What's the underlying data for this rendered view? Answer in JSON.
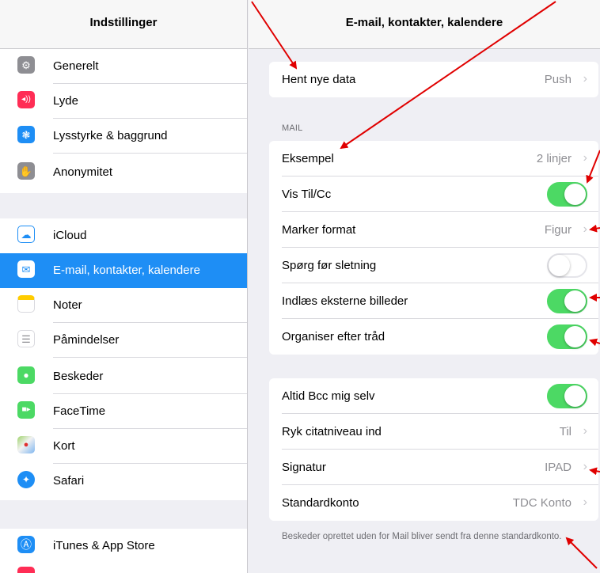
{
  "sidebar": {
    "title": "Indstillinger",
    "items": [
      {
        "label": "Generelt",
        "icon": "gear-icon",
        "color": "#8e8e93",
        "glyph": "⚙"
      },
      {
        "label": "Lyde",
        "icon": "speaker-icon",
        "color": "#ff2d55",
        "glyph": "🔊"
      },
      {
        "label": "Lysstyrke & baggrund",
        "icon": "flower-icon",
        "color": "#1e8ef5",
        "glyph": "❃"
      },
      {
        "label": "Anonymitet",
        "icon": "hand-icon",
        "color": "#8e8e93",
        "glyph": "✋"
      },
      {
        "label": "iCloud",
        "icon": "cloud-icon",
        "color": "#ffffff",
        "glyph": "☁"
      },
      {
        "label": "E-mail, kontakter, kalendere",
        "icon": "mail-icon",
        "color": "#1e8ef5",
        "glyph": "✉"
      },
      {
        "label": "Noter",
        "icon": "notes-icon",
        "color": "#ffcc00",
        "glyph": "▤"
      },
      {
        "label": "Påmindelser",
        "icon": "reminders-icon",
        "color": "#ffffff",
        "glyph": "☰"
      },
      {
        "label": "Beskeder",
        "icon": "messages-icon",
        "color": "#4cd964",
        "glyph": "💬"
      },
      {
        "label": "FaceTime",
        "icon": "facetime-icon",
        "color": "#4cd964",
        "glyph": "▶"
      },
      {
        "label": "Kort",
        "icon": "maps-icon",
        "color": "#f2f2f2",
        "glyph": "◆"
      },
      {
        "label": "Safari",
        "icon": "safari-icon",
        "color": "#1e8ef5",
        "glyph": "🧭"
      },
      {
        "label": "iTunes & App Store",
        "icon": "appstore-icon",
        "color": "#1e8ef5",
        "glyph": "Ⓐ"
      }
    ]
  },
  "detail": {
    "title": "E-mail, kontakter, kalendere",
    "fetch": {
      "label": "Hent nye data",
      "value": "Push"
    },
    "mail_header": "MAIL",
    "mail_rows": [
      {
        "label": "Eksempel",
        "value": "2 linjer"
      },
      {
        "label": "Vis Til/Cc",
        "toggle": "on"
      },
      {
        "label": "Marker format",
        "value": "Figur"
      },
      {
        "label": "Spørg før sletning",
        "toggle": "off"
      },
      {
        "label": "Indlæs eksterne billeder",
        "toggle": "on"
      },
      {
        "label": "Organiser efter tråd",
        "toggle": "on"
      }
    ],
    "other_rows": [
      {
        "label": "Altid Bcc mig selv",
        "toggle": "on"
      },
      {
        "label": "Ryk citatniveau ind",
        "value": "Til"
      },
      {
        "label": "Signatur",
        "value": "IPAD"
      },
      {
        "label": "Standardkonto",
        "value": "TDC Konto"
      }
    ],
    "footnote": "Beskeder oprettet uden for Mail bliver sendt fra denne standardkonto."
  },
  "colors": {
    "accent": "#1e8ef5",
    "toggle_on": "#4cd964",
    "annotation": "#e00000"
  }
}
